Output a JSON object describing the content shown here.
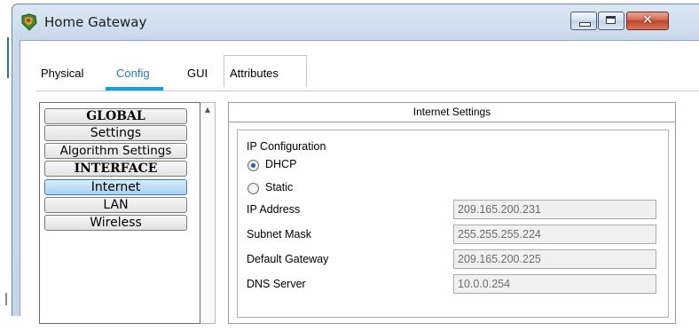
{
  "window": {
    "title": "Home Gateway"
  },
  "tabs": [
    {
      "label": "Physical"
    },
    {
      "label": "Config"
    },
    {
      "label": "GUI"
    },
    {
      "label": "Attributes"
    }
  ],
  "sidebar": {
    "items": [
      {
        "label": "GLOBAL",
        "header": true
      },
      {
        "label": "Settings"
      },
      {
        "label": "Algorithm Settings"
      },
      {
        "label": "INTERFACE",
        "header": true
      },
      {
        "label": "Internet",
        "selected": true
      },
      {
        "label": "LAN"
      },
      {
        "label": "Wireless"
      }
    ]
  },
  "panel": {
    "title": "Internet Settings",
    "ip_configuration_label": "IP Configuration",
    "mode_options": [
      {
        "label": "DHCP",
        "selected": true
      },
      {
        "label": "Static",
        "selected": false
      }
    ],
    "fields": [
      {
        "label": "IP Address",
        "value": "209.165.200.231"
      },
      {
        "label": "Subnet Mask",
        "value": "255.255.255.224"
      },
      {
        "label": "Default Gateway",
        "value": "209.165.200.225"
      },
      {
        "label": "DNS Server",
        "value": "10.0.0.254"
      }
    ]
  },
  "colors": {
    "active_tab_text": "#2a78c8",
    "active_tab_underline": "#1a9cd8",
    "selected_item": "#a9d2f2",
    "close_button": "#c0432a"
  }
}
